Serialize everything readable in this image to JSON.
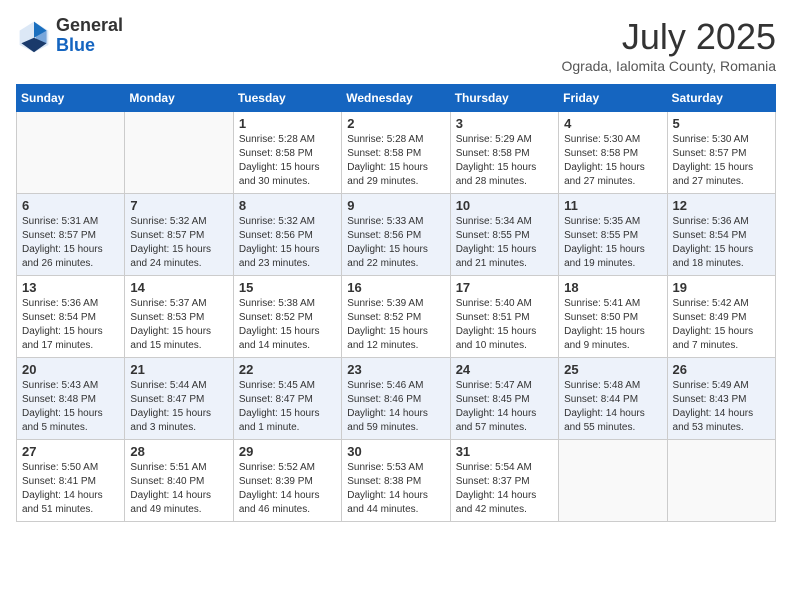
{
  "header": {
    "logo_general": "General",
    "logo_blue": "Blue",
    "month_year": "July 2025",
    "location": "Ograda, Ialomita County, Romania"
  },
  "weekdays": [
    "Sunday",
    "Monday",
    "Tuesday",
    "Wednesday",
    "Thursday",
    "Friday",
    "Saturday"
  ],
  "weeks": [
    [
      {
        "day": "",
        "info": ""
      },
      {
        "day": "",
        "info": ""
      },
      {
        "day": "1",
        "info": "Sunrise: 5:28 AM\nSunset: 8:58 PM\nDaylight: 15 hours\nand 30 minutes."
      },
      {
        "day": "2",
        "info": "Sunrise: 5:28 AM\nSunset: 8:58 PM\nDaylight: 15 hours\nand 29 minutes."
      },
      {
        "day": "3",
        "info": "Sunrise: 5:29 AM\nSunset: 8:58 PM\nDaylight: 15 hours\nand 28 minutes."
      },
      {
        "day": "4",
        "info": "Sunrise: 5:30 AM\nSunset: 8:58 PM\nDaylight: 15 hours\nand 27 minutes."
      },
      {
        "day": "5",
        "info": "Sunrise: 5:30 AM\nSunset: 8:57 PM\nDaylight: 15 hours\nand 27 minutes."
      }
    ],
    [
      {
        "day": "6",
        "info": "Sunrise: 5:31 AM\nSunset: 8:57 PM\nDaylight: 15 hours\nand 26 minutes."
      },
      {
        "day": "7",
        "info": "Sunrise: 5:32 AM\nSunset: 8:57 PM\nDaylight: 15 hours\nand 24 minutes."
      },
      {
        "day": "8",
        "info": "Sunrise: 5:32 AM\nSunset: 8:56 PM\nDaylight: 15 hours\nand 23 minutes."
      },
      {
        "day": "9",
        "info": "Sunrise: 5:33 AM\nSunset: 8:56 PM\nDaylight: 15 hours\nand 22 minutes."
      },
      {
        "day": "10",
        "info": "Sunrise: 5:34 AM\nSunset: 8:55 PM\nDaylight: 15 hours\nand 21 minutes."
      },
      {
        "day": "11",
        "info": "Sunrise: 5:35 AM\nSunset: 8:55 PM\nDaylight: 15 hours\nand 19 minutes."
      },
      {
        "day": "12",
        "info": "Sunrise: 5:36 AM\nSunset: 8:54 PM\nDaylight: 15 hours\nand 18 minutes."
      }
    ],
    [
      {
        "day": "13",
        "info": "Sunrise: 5:36 AM\nSunset: 8:54 PM\nDaylight: 15 hours\nand 17 minutes."
      },
      {
        "day": "14",
        "info": "Sunrise: 5:37 AM\nSunset: 8:53 PM\nDaylight: 15 hours\nand 15 minutes."
      },
      {
        "day": "15",
        "info": "Sunrise: 5:38 AM\nSunset: 8:52 PM\nDaylight: 15 hours\nand 14 minutes."
      },
      {
        "day": "16",
        "info": "Sunrise: 5:39 AM\nSunset: 8:52 PM\nDaylight: 15 hours\nand 12 minutes."
      },
      {
        "day": "17",
        "info": "Sunrise: 5:40 AM\nSunset: 8:51 PM\nDaylight: 15 hours\nand 10 minutes."
      },
      {
        "day": "18",
        "info": "Sunrise: 5:41 AM\nSunset: 8:50 PM\nDaylight: 15 hours\nand 9 minutes."
      },
      {
        "day": "19",
        "info": "Sunrise: 5:42 AM\nSunset: 8:49 PM\nDaylight: 15 hours\nand 7 minutes."
      }
    ],
    [
      {
        "day": "20",
        "info": "Sunrise: 5:43 AM\nSunset: 8:48 PM\nDaylight: 15 hours\nand 5 minutes."
      },
      {
        "day": "21",
        "info": "Sunrise: 5:44 AM\nSunset: 8:47 PM\nDaylight: 15 hours\nand 3 minutes."
      },
      {
        "day": "22",
        "info": "Sunrise: 5:45 AM\nSunset: 8:47 PM\nDaylight: 15 hours\nand 1 minute."
      },
      {
        "day": "23",
        "info": "Sunrise: 5:46 AM\nSunset: 8:46 PM\nDaylight: 14 hours\nand 59 minutes."
      },
      {
        "day": "24",
        "info": "Sunrise: 5:47 AM\nSunset: 8:45 PM\nDaylight: 14 hours\nand 57 minutes."
      },
      {
        "day": "25",
        "info": "Sunrise: 5:48 AM\nSunset: 8:44 PM\nDaylight: 14 hours\nand 55 minutes."
      },
      {
        "day": "26",
        "info": "Sunrise: 5:49 AM\nSunset: 8:43 PM\nDaylight: 14 hours\nand 53 minutes."
      }
    ],
    [
      {
        "day": "27",
        "info": "Sunrise: 5:50 AM\nSunset: 8:41 PM\nDaylight: 14 hours\nand 51 minutes."
      },
      {
        "day": "28",
        "info": "Sunrise: 5:51 AM\nSunset: 8:40 PM\nDaylight: 14 hours\nand 49 minutes."
      },
      {
        "day": "29",
        "info": "Sunrise: 5:52 AM\nSunset: 8:39 PM\nDaylight: 14 hours\nand 46 minutes."
      },
      {
        "day": "30",
        "info": "Sunrise: 5:53 AM\nSunset: 8:38 PM\nDaylight: 14 hours\nand 44 minutes."
      },
      {
        "day": "31",
        "info": "Sunrise: 5:54 AM\nSunset: 8:37 PM\nDaylight: 14 hours\nand 42 minutes."
      },
      {
        "day": "",
        "info": ""
      },
      {
        "day": "",
        "info": ""
      }
    ]
  ]
}
